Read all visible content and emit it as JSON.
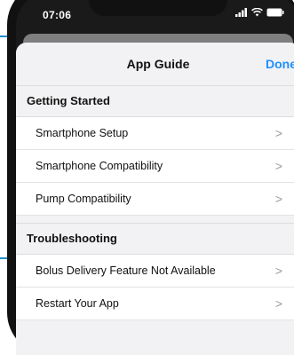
{
  "status": {
    "time": "07:06"
  },
  "nav": {
    "title": "App Guide",
    "done_label": "Done"
  },
  "sections": [
    {
      "header": "Getting Started",
      "items": [
        "Smartphone Setup",
        "Smartphone Compatibility",
        "Pump Compatibility"
      ]
    },
    {
      "header": "Troubleshooting",
      "items": [
        "Bolus Delivery Feature Not Available",
        "Restart Your App"
      ]
    }
  ],
  "chevron": ">",
  "colors": {
    "accent": "#1e90ff",
    "decor_line": "#1a8fc9"
  }
}
